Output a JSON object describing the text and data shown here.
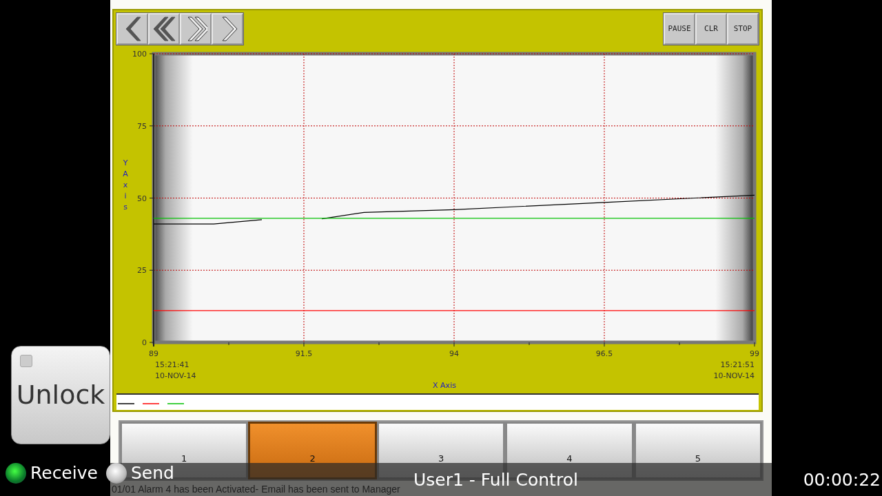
{
  "toolbar": {
    "nav_buttons": [
      {
        "kind": "single-left"
      },
      {
        "kind": "double-left"
      },
      {
        "kind": "double-right"
      },
      {
        "kind": "single-right"
      }
    ],
    "action_buttons": [
      "PAUSE",
      "CLR",
      "STOP"
    ]
  },
  "trend": {
    "chart_data": {
      "type": "line",
      "grid": true,
      "xlabel": "X Axis",
      "ylabel": "Y Axis",
      "x": [
        89,
        90,
        90.8,
        91.3,
        91.8,
        92.5,
        94,
        96.5,
        99
      ],
      "xlim": [
        89,
        99
      ],
      "ylim": [
        0,
        100
      ],
      "xticks": [
        {
          "value": 89,
          "label": "89\n15:21:41\n10-NOV-14"
        },
        {
          "value": 91.5,
          "label": "91.5"
        },
        {
          "value": 94,
          "label": "94"
        },
        {
          "value": 96.5,
          "label": "96.5"
        },
        {
          "value": 99,
          "label": "99\n15:21:51\n10-NOV-14"
        }
      ],
      "yticks": [
        0,
        25,
        50,
        75,
        100
      ],
      "series": [
        {
          "color": "#000000",
          "values": [
            41,
            41,
            42.5,
            null,
            42.8,
            45,
            46,
            48.5,
            51
          ]
        },
        {
          "color": "#ff0000",
          "values": [
            11,
            11,
            11,
            11,
            11,
            11,
            11,
            11,
            11
          ]
        },
        {
          "color": "#00c000",
          "values": [
            43,
            43,
            43,
            43,
            43,
            43,
            43,
            43,
            43
          ]
        }
      ]
    }
  },
  "tabs": [
    {
      "label": "1",
      "selected": false
    },
    {
      "label": "2",
      "selected": true
    },
    {
      "label": "3",
      "selected": false
    },
    {
      "label": "4",
      "selected": false
    },
    {
      "label": "5",
      "selected": false
    }
  ],
  "unlock_button": "Unlock",
  "indicators": [
    {
      "label": "Receive",
      "on": true
    },
    {
      "label": "Send",
      "on": false
    }
  ],
  "user": "User1 - Full Control",
  "timer": "00:00:22",
  "alarm_message": "01/01 Alarm 4 has been Activated- Email has been sent to Manager"
}
